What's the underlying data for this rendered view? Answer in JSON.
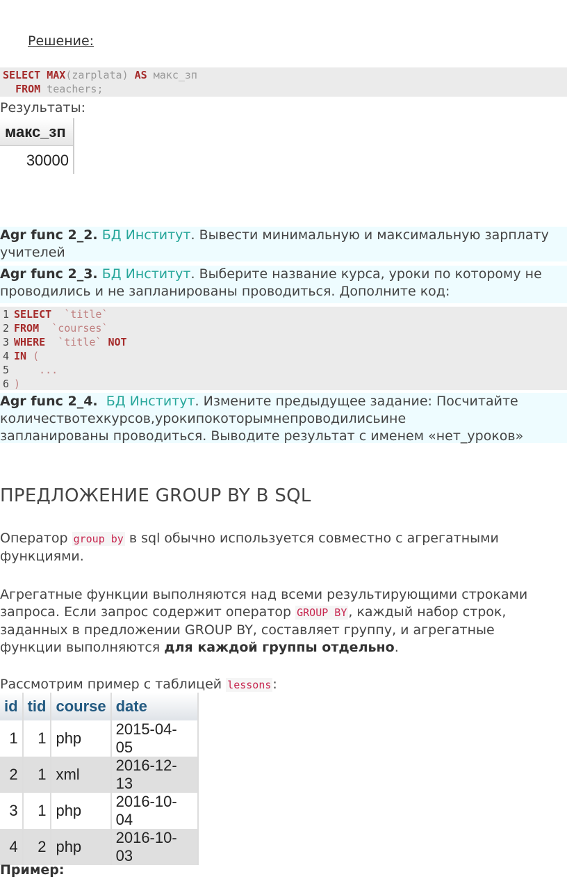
{
  "solution_heading": "Решение:",
  "code1": {
    "line1": [
      {
        "t": "SELECT",
        "c": "kw"
      },
      {
        "t": " "
      },
      {
        "t": "MAX",
        "c": "fn"
      },
      {
        "t": "(",
        "c": "gr"
      },
      {
        "t": "zarplata",
        "c": "gr"
      },
      {
        "t": ")",
        "c": "gr"
      },
      {
        "t": " "
      },
      {
        "t": "AS",
        "c": "kw"
      },
      {
        "t": " макс_зп",
        "c": "gr"
      }
    ],
    "line2": [
      {
        "t": "  "
      },
      {
        "t": "FROM",
        "c": "kw"
      },
      {
        "t": " teachers;",
        "c": "gr"
      }
    ]
  },
  "results_label": "Результаты:",
  "result_table": {
    "header": "макс_зп",
    "value": "30000"
  },
  "task2": {
    "label": "Agr func 2_2.",
    "db": "БД Институт",
    "text": ". Вывести минимальную и максимальную зарплату",
    "text2": "учителей"
  },
  "task3": {
    "label": "Agr func 2_3.",
    "db": "БД Институт",
    "text": ". Выберите название курса, уроки по которому не",
    "text2": "проводились и не запланированы проводиться. Дополните код:"
  },
  "code2": [
    {
      "n": "1",
      "parts": [
        {
          "t": "SELECT",
          "c": "kw"
        },
        {
          "t": "  "
        },
        {
          "t": "`title`",
          "c": "str"
        }
      ]
    },
    {
      "n": "2",
      "parts": [
        {
          "t": "FROM",
          "c": "kw"
        },
        {
          "t": "  "
        },
        {
          "t": "`courses`",
          "c": "str"
        }
      ]
    },
    {
      "n": "3",
      "parts": [
        {
          "t": "WHERE",
          "c": "kw"
        },
        {
          "t": "  "
        },
        {
          "t": "`title`",
          "c": "str"
        },
        {
          "t": " "
        },
        {
          "t": "NOT",
          "c": "kw"
        }
      ]
    },
    {
      "n": "4",
      "parts": [
        {
          "t": "IN",
          "c": "kw"
        },
        {
          "t": " "
        },
        {
          "t": "(",
          "c": "str"
        }
      ]
    },
    {
      "n": "5",
      "parts": [
        {
          "t": "    "
        },
        {
          "t": "...",
          "c": "str"
        }
      ]
    },
    {
      "n": "6",
      "parts": [
        {
          "t": ")",
          "c": "str"
        }
      ]
    }
  ],
  "task4": {
    "label": "Agr func 2_4.",
    "db": "БД Институт",
    "line1_rest": ". Измените предыдущее задание: Посчитайте",
    "line2_words": [
      "количество",
      "тех",
      "курсов,",
      "уроки",
      "по",
      "которым",
      "не",
      "проводились",
      "и",
      "не"
    ],
    "line3": "запланированы проводиться. Выводите результат с именем «нет_уроков»"
  },
  "group_heading": "ПРЕДЛОЖЕНИЕ GROUP BY В SQL",
  "para1": {
    "pre": "Оператор ",
    "code": "group by",
    "post": " в sql обычно используется совместно с агрегатными",
    "line2": "функциями."
  },
  "para2": {
    "line1": "Агрегатные функции выполняются над всеми результирующими строками",
    "line2_pre": "запроса. Если запрос содержит оператор ",
    "line2_code": "GROUP BY",
    "line2_post": ", каждый набор строк,",
    "line3": "заданных в предложении GROUP BY, составляет группу, и агрегатные",
    "line4_pre": "функции выполняются ",
    "line4_bold": "для каждой группы отдельно",
    "line4_post": "."
  },
  "para3": {
    "pre": "Рассмотрим пример с таблицей ",
    "code": "lessons",
    "post": ":"
  },
  "lessons_table": {
    "headers": [
      "id",
      "tid",
      "course",
      "date"
    ],
    "rows": [
      [
        "1",
        "1",
        "php",
        "2015-04-05"
      ],
      [
        "2",
        "1",
        "xml",
        "2016-12-13"
      ],
      [
        "3",
        "1",
        "php",
        "2016-10-04"
      ],
      [
        "4",
        "2",
        "php",
        "2016-10-03"
      ]
    ]
  },
  "example_label": "Пример:"
}
